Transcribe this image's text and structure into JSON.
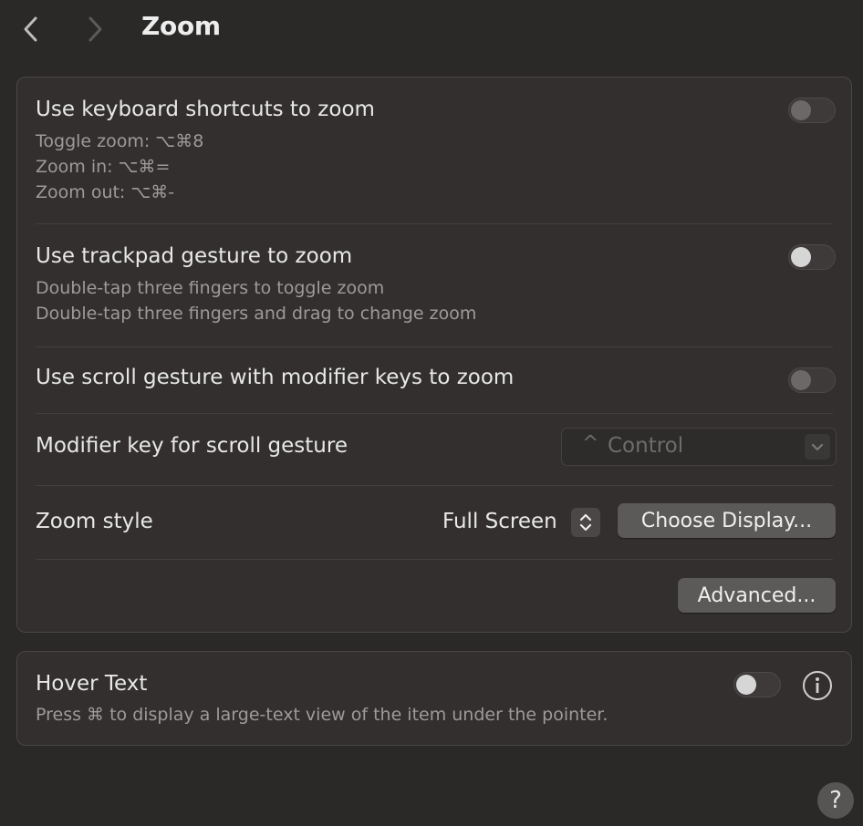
{
  "header": {
    "title": "Zoom",
    "back_icon": "chevron-left-icon",
    "forward_icon": "chevron-right-icon"
  },
  "keyboard": {
    "title": "Use keyboard shortcuts to zoom",
    "lines": [
      "Toggle zoom: ⌥⌘8",
      "Zoom in: ⌥⌘=",
      "Zoom out: ⌥⌘-"
    ],
    "enabled": false
  },
  "trackpad": {
    "title": "Use trackpad gesture to zoom",
    "lines": [
      "Double-tap three fingers to toggle zoom",
      "Double-tap three fingers and drag to change zoom"
    ],
    "enabled": false
  },
  "scroll": {
    "title": "Use scroll gesture with modifier keys to zoom",
    "enabled": false
  },
  "modifier": {
    "title": "Modifier key for scroll gesture",
    "symbol": "^",
    "value": "Control"
  },
  "zoom_style": {
    "title": "Zoom style",
    "value": "Full Screen",
    "choose_display_label": "Choose Display..."
  },
  "advanced": {
    "label": "Advanced..."
  },
  "hover_text": {
    "title": "Hover Text",
    "description": "Press ⌘ to display a large-text view of the item under the pointer.",
    "enabled": false
  },
  "help": {
    "label": "?"
  },
  "colors": {
    "background": "#2b2928",
    "panel": "#322f2e",
    "secondary_text": "#9d9b9a",
    "button": "#5c5a59"
  }
}
